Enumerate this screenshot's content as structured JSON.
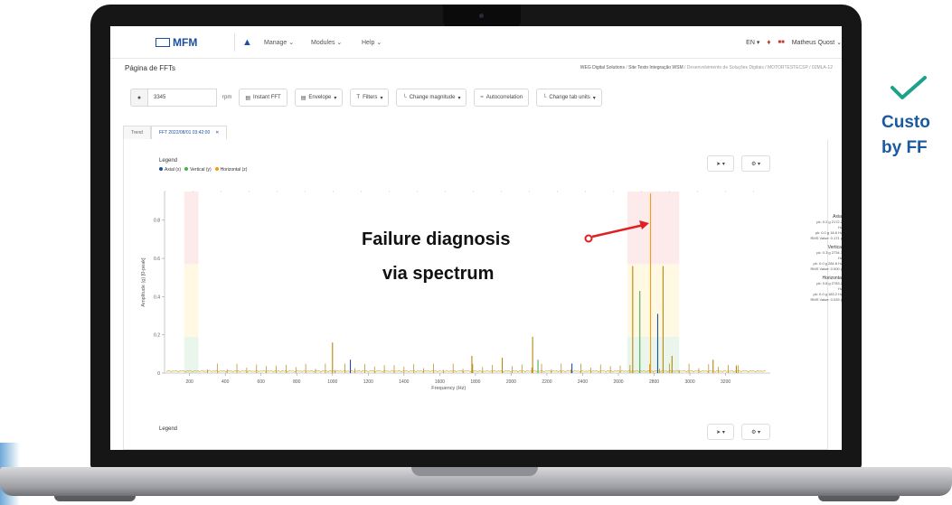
{
  "app": {
    "logo_text": "MFM",
    "nav": {
      "manage": "Manage",
      "modules": "Modules",
      "help": "Help"
    },
    "lang": "EN",
    "user": "Matheus Quost"
  },
  "page": {
    "title": "Página de FFTs",
    "breadcrumb": [
      "WEG Digital Solutions",
      "Site Testo Integração WSM",
      "Desenvolvimento de Soluções Digitais",
      "MOTORTESTECSP",
      "02MLA-12"
    ]
  },
  "toolbar": {
    "rpm_value": "3345",
    "rpm_unit": "rpm",
    "instant_fft": "Instant FFT",
    "envelope": "Envelope",
    "filters": "Filters",
    "change_magnitude": "Change magnitude",
    "autocorrelation": "Autocorrelation",
    "change_tab_units": "Change tab units"
  },
  "tabs": [
    {
      "label": "Trend"
    },
    {
      "label": "FFT 2022/08/01 03:42:00",
      "close": "✕"
    }
  ],
  "legend": {
    "title": "Legend",
    "items": [
      {
        "label": "Axial (x)",
        "color": "#1f4fa0"
      },
      {
        "label": "Vertical (y)",
        "color": "#4caf50"
      },
      {
        "label": "Horizontal (z)",
        "color": "#f39c12"
      }
    ],
    "second_title": "Legend"
  },
  "chart_data": {
    "type": "line",
    "xlabel": "Frequency (Hz)",
    "ylabel": "Amplitude (g) [0-peak]",
    "xlim": [
      60,
      3450
    ],
    "ylim": [
      0,
      0.95
    ],
    "x_ticks": [
      200,
      400,
      600,
      800,
      1000,
      1200,
      1400,
      1600,
      1800,
      2000,
      2200,
      2400,
      2600,
      2800,
      3000,
      3200
    ],
    "x_tick_labels": [
      "200",
      "400",
      "600",
      "800",
      "1000",
      "1200",
      "1400",
      "1600",
      "1800",
      "2000",
      "2200",
      "2400",
      "2600",
      "2800",
      "3000",
      "3200"
    ],
    "y_ticks": [
      0,
      0.2,
      0.4,
      0.6,
      0.8
    ],
    "y_tick_labels": [
      "0",
      "0.2",
      "0.4",
      "0.6",
      "0.8"
    ],
    "bands": [
      {
        "x_range": [
          170,
          250
        ],
        "colors": [
          "#e8f5e9",
          "#fff8e1",
          "#fde8e8"
        ]
      },
      {
        "x_range": [
          2650,
          2940
        ],
        "colors": [
          "#e8f5e9",
          "#fff8e1",
          "#fde8e8"
        ]
      }
    ],
    "peaks": [
      {
        "x": 1000,
        "y": 0.16,
        "color": "#b8860b"
      },
      {
        "x": 1100,
        "y": 0.07,
        "color": "#1f4fa0"
      },
      {
        "x": 1780,
        "y": 0.09,
        "color": "#b8860b"
      },
      {
        "x": 1950,
        "y": 0.08,
        "color": "#b8860b"
      },
      {
        "x": 2120,
        "y": 0.19,
        "color": "#b8860b"
      },
      {
        "x": 2150,
        "y": 0.07,
        "color": "#4caf50"
      },
      {
        "x": 2340,
        "y": 0.05,
        "color": "#1f4fa0"
      },
      {
        "x": 2680,
        "y": 0.56,
        "color": "#b8860b"
      },
      {
        "x": 2720,
        "y": 0.43,
        "color": "#4caf50"
      },
      {
        "x": 2780,
        "y": 0.94,
        "color": "#f39c12"
      },
      {
        "x": 2820,
        "y": 0.31,
        "color": "#1f4fa0"
      },
      {
        "x": 2850,
        "y": 0.56,
        "color": "#b8860b"
      },
      {
        "x": 2900,
        "y": 0.09,
        "color": "#b8860b"
      },
      {
        "x": 3130,
        "y": 0.07,
        "color": "#b8860b"
      },
      {
        "x": 3260,
        "y": 0.04,
        "color": "#b8860b"
      }
    ]
  },
  "side_info": [
    {
      "head": "Axial",
      "lines": [
        "pk: 0.2 g 2172.2",
        "Hz",
        "pk: 0.0 g 18.6 Hz",
        "RMS Value: 0.171 g"
      ]
    },
    {
      "head": "Vertical",
      "lines": [
        "pk: 0.3 g 2734.3",
        "Hz",
        "pk: 0.0 g 284.8 Hz",
        "RMS Value: 0.000 g"
      ]
    },
    {
      "head": "Horizontal",
      "lines": [
        "pk: 0.8 g 2783.2",
        "Hz",
        "pk: 0.0 g 183.2 Hz",
        "RMS Value: 0.033 g"
      ]
    }
  ],
  "annotation": {
    "line1": "Failure diagnosis",
    "line2": "via spectrum"
  },
  "promo": {
    "line1": "Custo",
    "line2": "by FF",
    "check_color": "#1aa38a"
  }
}
